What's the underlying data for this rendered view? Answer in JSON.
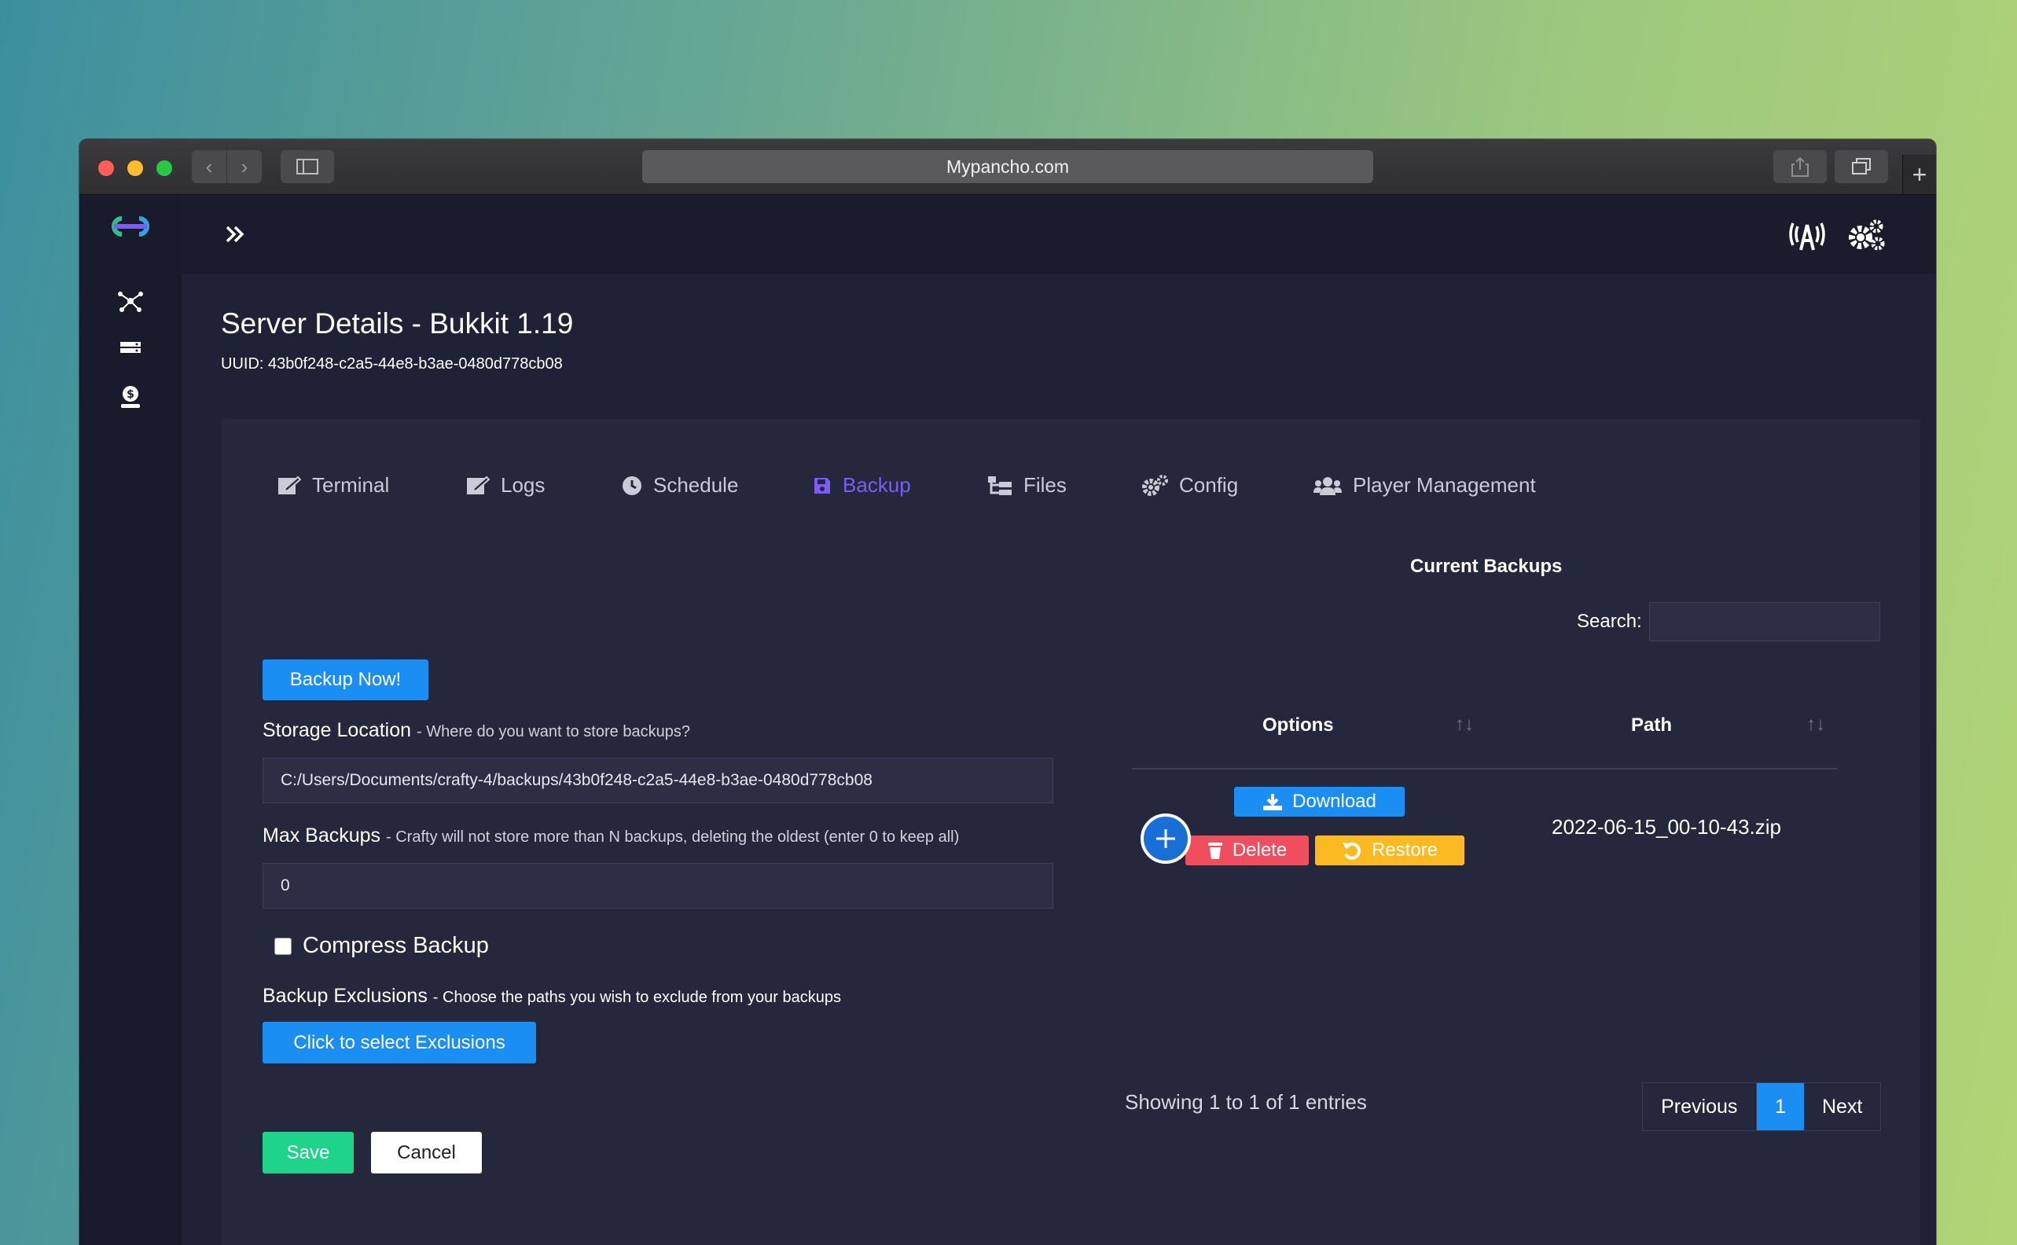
{
  "browser": {
    "url": "Mypancho.com"
  },
  "page": {
    "title": "Server Details - Bukkit 1.19",
    "uuid": "UUID: 43b0f248-c2a5-44e8-b3ae-0480d778cb08"
  },
  "tabs": [
    {
      "label": "Terminal",
      "icon": "terminal-icon"
    },
    {
      "label": "Logs",
      "icon": "logs-icon"
    },
    {
      "label": "Schedule",
      "icon": "clock-icon"
    },
    {
      "label": "Backup",
      "icon": "save-icon",
      "active": true
    },
    {
      "label": "Files",
      "icon": "files-icon"
    },
    {
      "label": "Config",
      "icon": "gears-icon"
    },
    {
      "label": "Player Management",
      "icon": "users-icon"
    }
  ],
  "backup_form": {
    "backup_now_label": "Backup Now!",
    "storage_label": "Storage Location",
    "storage_hint": "- Where do you want to store backups?",
    "storage_value": "C:/Users/Documents/crafty-4/backups/43b0f248-c2a5-44e8-b3ae-0480d778cb08",
    "max_label": "Max Backups",
    "max_hint": "- Crafty will not store more than N backups, deleting the oldest (enter 0 to keep all)",
    "max_value": "0",
    "compress_label": "Compress Backup",
    "exclusions_label": "Backup Exclusions",
    "exclusions_hint": "- Choose the paths you wish to exclude from your backups",
    "exclusions_button": "Click to select Exclusions",
    "save_label": "Save",
    "cancel_label": "Cancel"
  },
  "backups_table": {
    "heading": "Current Backups",
    "search_label": "Search:",
    "search_value": "",
    "columns": [
      "Options",
      "Path"
    ],
    "rows": [
      {
        "path": "2022-06-15_00-10-43.zip",
        "download_label": "Download",
        "delete_label": "Delete",
        "restore_label": "Restore"
      }
    ],
    "info": "Showing 1 to 1 of 1 entries",
    "pagination": {
      "previous": "Previous",
      "current": "1",
      "next": "Next"
    }
  },
  "colors": {
    "accent": "#7b5cf5",
    "primary_button": "#1a8ef2",
    "delete": "#f04e5e",
    "restore": "#fdb921",
    "save": "#1fd48a"
  }
}
